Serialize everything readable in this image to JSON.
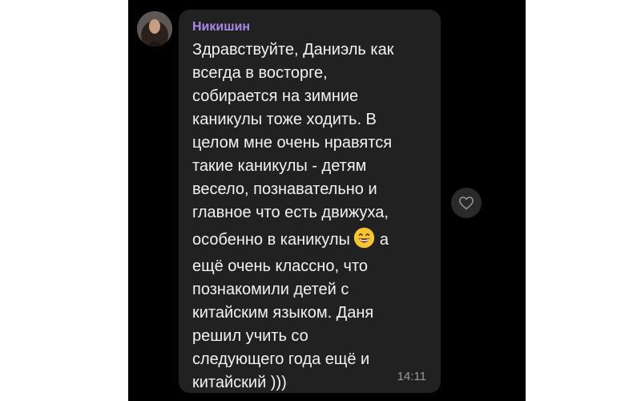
{
  "message": {
    "sender": "Никишин",
    "lines": [
      "Здравствуйте, Даниэль как",
      "всегда в восторге,",
      "собирается на зимние",
      "каникулы тоже ходить. В",
      "целом мне очень нравятся",
      "такие каникулы - детям",
      "весело, познавательно и",
      "главное что есть движуха,",
      "особенно в каникулы",
      "а",
      "ещё очень классно, что",
      "познакомили детей с",
      "китайским языком. Даня",
      "решил учить со",
      "следующего года ещё и",
      "китайский )))"
    ],
    "time": "14:11"
  },
  "icons": {
    "avatar": "user-avatar",
    "emoji": "grinning-face-emoji",
    "reaction": "heart-icon"
  },
  "colors": {
    "background": "#000000",
    "bubble": "#212121",
    "sender": "#a888e8",
    "text": "#f2f2f2",
    "time": "#9a9a9a"
  }
}
